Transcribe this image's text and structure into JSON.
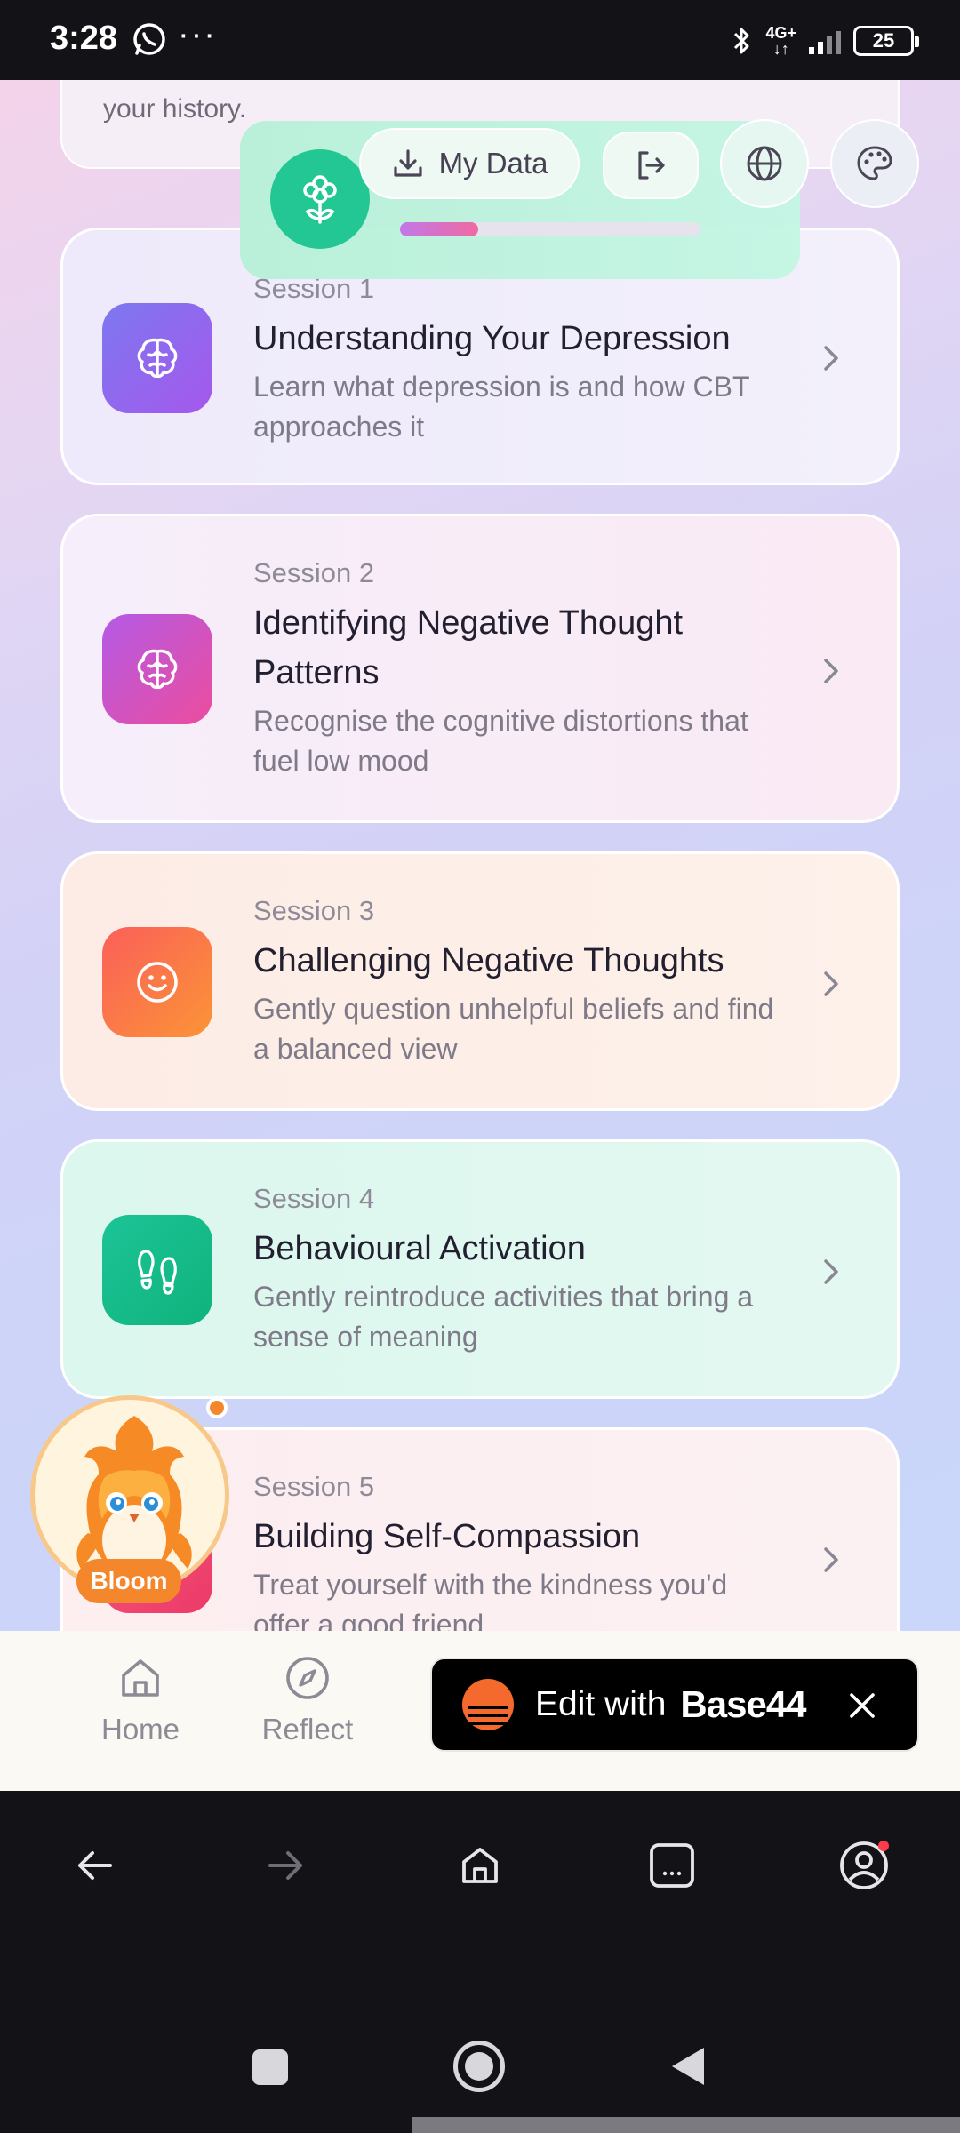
{
  "status_bar": {
    "time": "3:28",
    "dots": "···",
    "network_top": "4G+",
    "network_bottom": "↓↑",
    "battery": "25"
  },
  "history_card": {
    "text": "your history."
  },
  "header": {
    "my_data_label": "My Data",
    "progress_fraction": 0.26,
    "icons": [
      "flower-logo-icon",
      "download-icon",
      "logout-icon",
      "globe-icon",
      "palette-icon"
    ]
  },
  "sessions": [
    {
      "number": "Session 1",
      "title": "Understanding Your Depression",
      "description": "Learn what depression is and how CBT approaches it",
      "icon": "brain-icon",
      "color": "#8b5cf6"
    },
    {
      "number": "Session 2",
      "title": "Identifying Negative Thought Patterns",
      "description": "Recognise the cognitive distortions that fuel low mood",
      "icon": "brain-icon",
      "color": "#d946a8"
    },
    {
      "number": "Session 3",
      "title": "Challenging Negative Thoughts",
      "description": "Gently question unhelpful beliefs and find a balanced view",
      "icon": "smile-icon",
      "color": "#fb6f4c"
    },
    {
      "number": "Session 4",
      "title": "Behavioural Activation",
      "description": "Gently reintroduce activities that bring a sense of meaning",
      "icon": "footprints-icon",
      "color": "#14c08c"
    },
    {
      "number": "Session 5",
      "title": "Building Self-Compassion",
      "description": "Treat yourself with the kindness you'd offer a good friend",
      "icon": "heart-icon",
      "color": "#f0436d"
    }
  ],
  "mascot": {
    "name": "Bloom"
  },
  "bottom_nav": {
    "items": [
      {
        "label": "Home",
        "icon": "home-icon"
      },
      {
        "label": "Reflect",
        "icon": "compass-icon"
      }
    ]
  },
  "edit_banner": {
    "text": "Edit with",
    "brand": "Base44"
  },
  "colors": {
    "accent": "#22c793",
    "mascot_orange": "#f4872c"
  }
}
